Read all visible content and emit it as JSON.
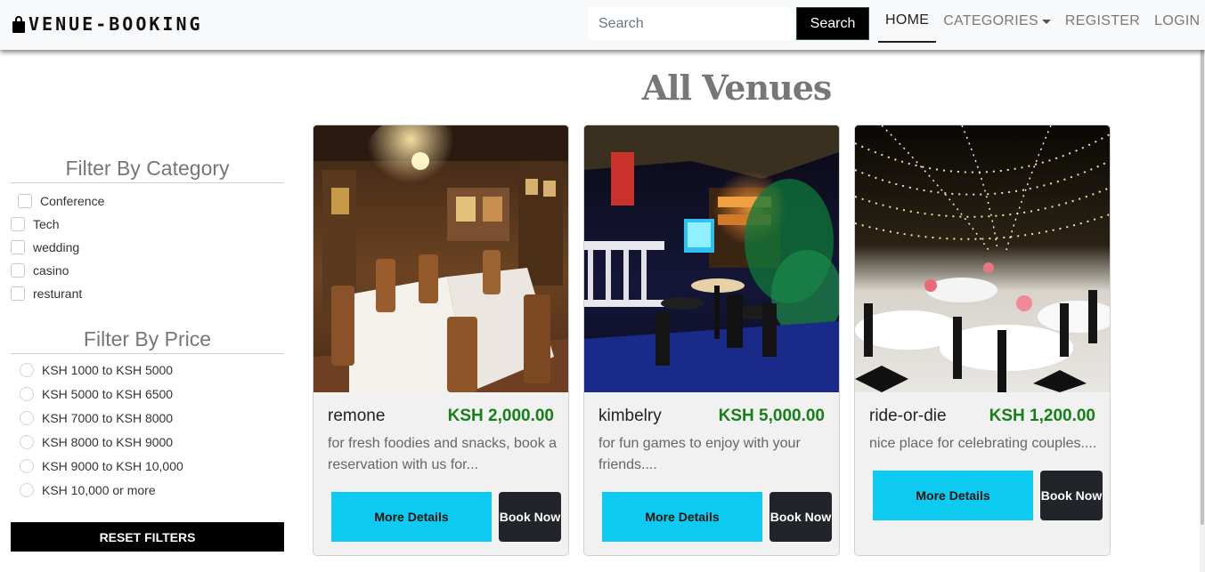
{
  "nav": {
    "brand": "VENUE-BOOKING",
    "brand_icon": "shopping-bag-icon",
    "search_placeholder": "Search",
    "search_button": "Search",
    "links": [
      "HOME",
      "CATEGORIES",
      "REGISTER",
      "LOGIN"
    ]
  },
  "sidebar": {
    "category_title": "Filter By Category",
    "categories": [
      "Conference",
      "Tech",
      "wedding",
      "casino",
      "resturant"
    ],
    "price_title": "Filter By Price",
    "prices": [
      "KSH 1000 to KSH 5000",
      "KSH 5000 to KSH 6500",
      "KSH 7000 to KSH 8000",
      "KSH 8000 to KSH 9000",
      "KSH 9000 to KSH 10,000",
      "KSH 10,000 or more"
    ],
    "reset_label": "RESET FILTERS"
  },
  "main": {
    "title": "All Venues",
    "venues": [
      {
        "name": "remone",
        "price": "KSH 2,000.00",
        "description": "for fresh foodies and snacks, book a reservation with us for...",
        "more_label": "More Details",
        "book_label": "Book Now"
      },
      {
        "name": "kimbelry",
        "price": "KSH 5,000.00",
        "description": "for fun games to enjoy with your friends....",
        "more_label": "More Details",
        "book_label": "Book Now"
      },
      {
        "name": "ride-or-die",
        "price": "KSH 1,200.00",
        "description": "nice place for celebrating couples....",
        "more_label": "More Details",
        "book_label": "Book Now"
      }
    ]
  },
  "colors": {
    "price_green": "#15801a",
    "more_button": "#0dcaf0",
    "book_button": "#212529"
  }
}
